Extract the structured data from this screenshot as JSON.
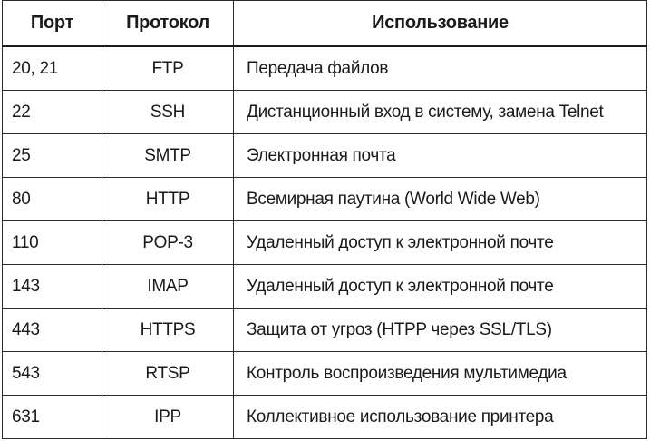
{
  "table": {
    "headers": {
      "port": "Порт",
      "protocol": "Протокол",
      "usage": "Использование"
    },
    "rows": [
      {
        "port": "20, 21",
        "protocol": "FTP",
        "usage": "Передача файлов"
      },
      {
        "port": "22",
        "protocol": "SSH",
        "usage": "Дистанционный вход в систему, замена Telnet"
      },
      {
        "port": "25",
        "protocol": "SMTP",
        "usage": "Электронная почта"
      },
      {
        "port": "80",
        "protocol": "HTTP",
        "usage": "Всемирная паутина (World Wide Web)"
      },
      {
        "port": "110",
        "protocol": "POP-3",
        "usage": "Удаленный доступ к электронной почте"
      },
      {
        "port": "143",
        "protocol": "IMAP",
        "usage": "Удаленный доступ к электронной почте"
      },
      {
        "port": "443",
        "protocol": "HTTPS",
        "usage": "Защита от угроз (HTPP через SSL/TLS)"
      },
      {
        "port": "543",
        "protocol": "RTSP",
        "usage": "Контроль воспроизведения мультимедиа"
      },
      {
        "port": "631",
        "protocol": "IPP",
        "usage": "Коллективное использование принтера"
      }
    ]
  }
}
